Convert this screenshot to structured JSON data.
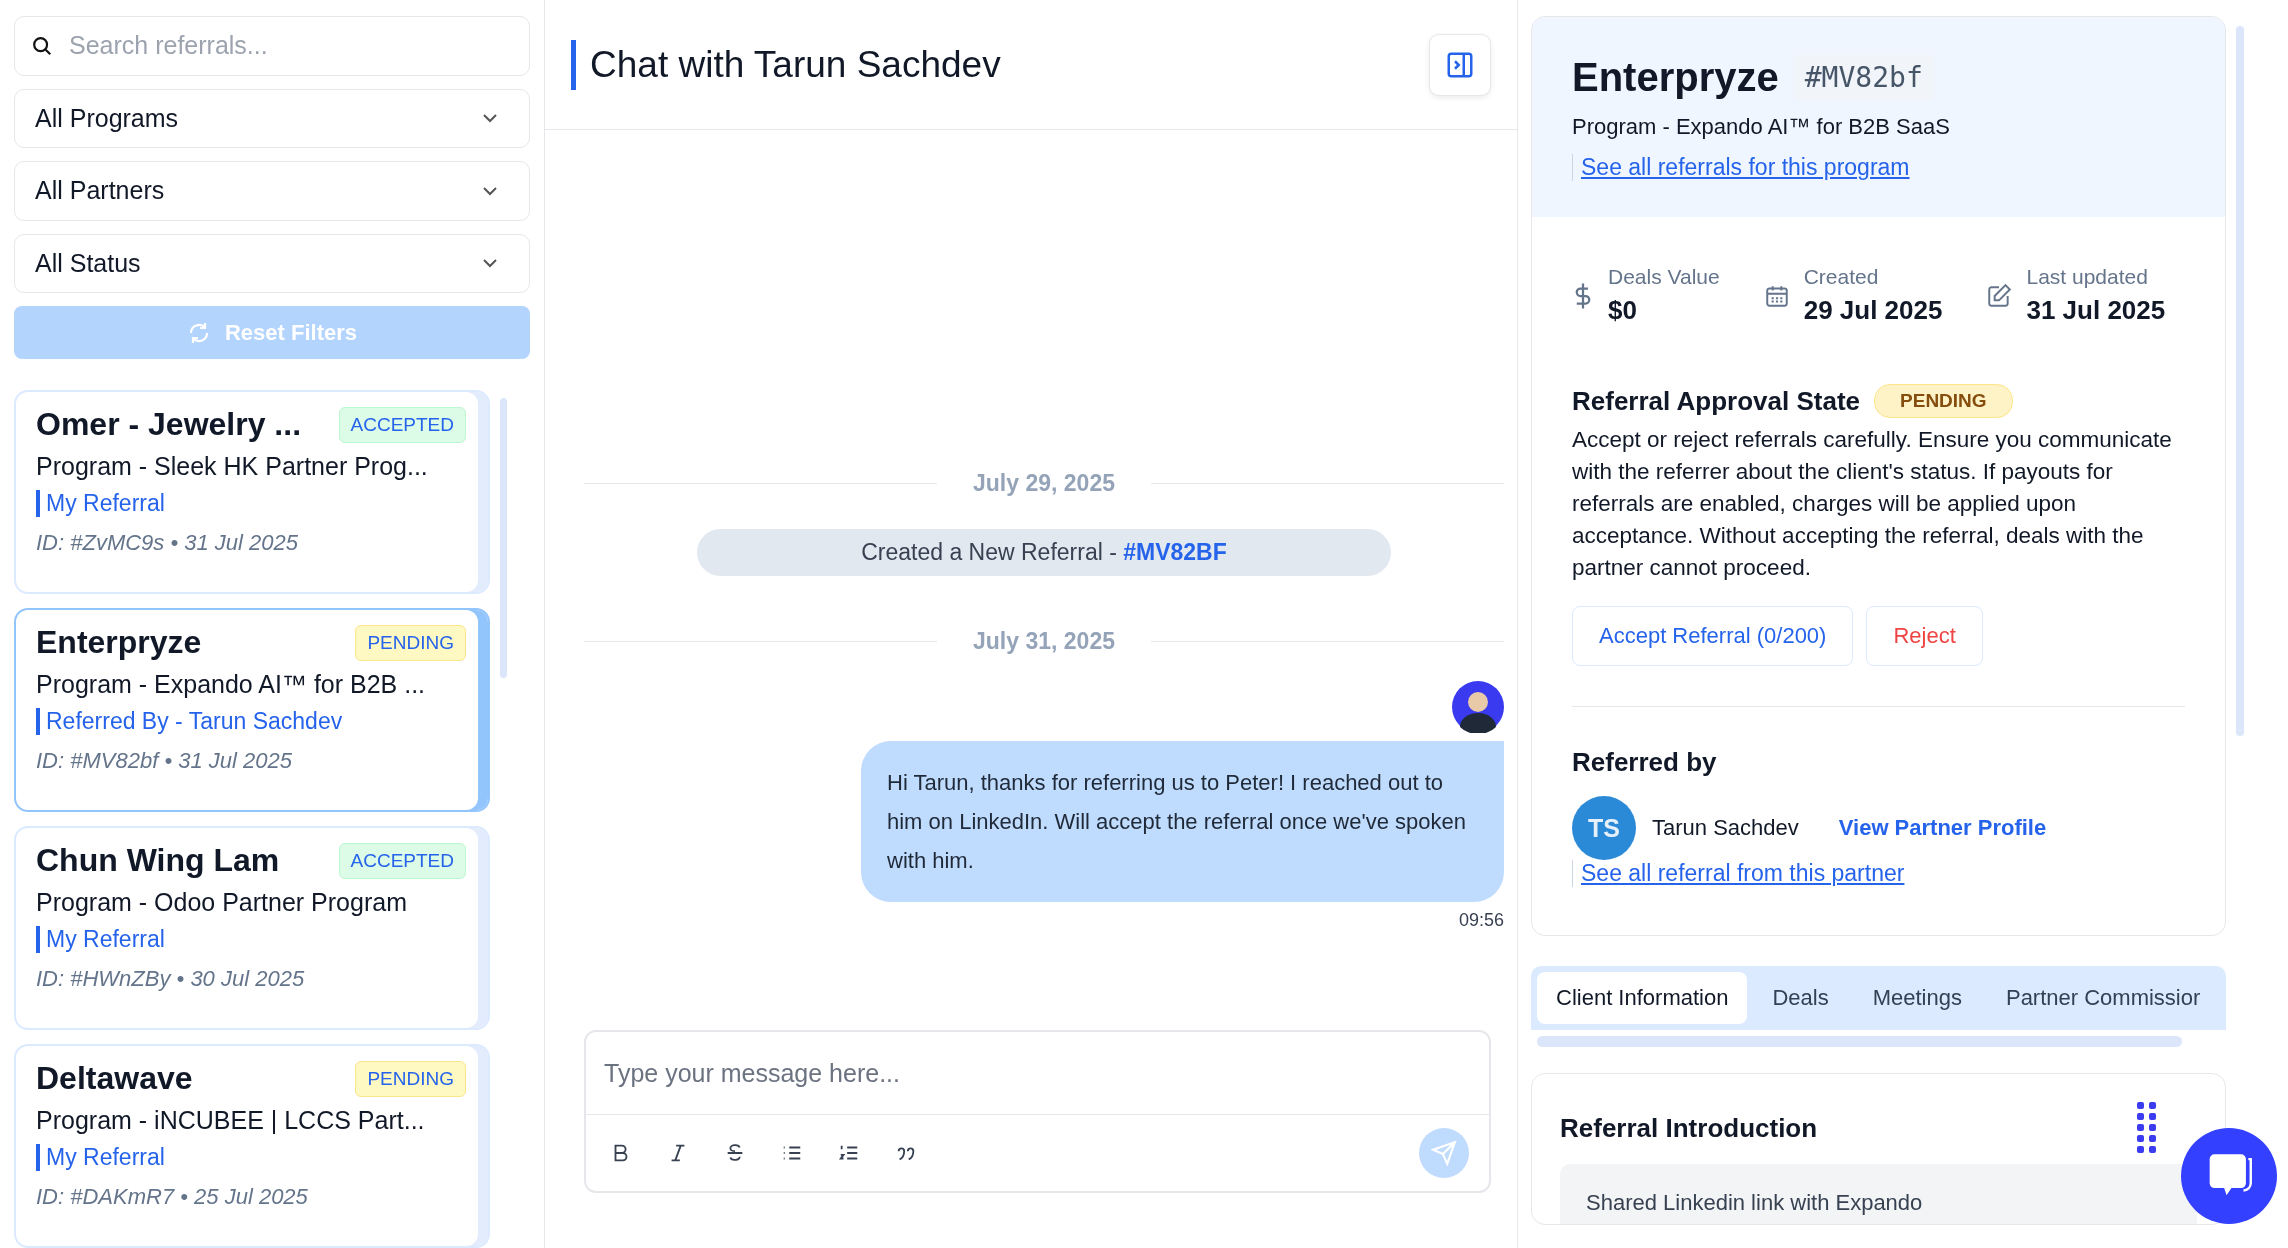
{
  "sidebar": {
    "search": {
      "placeholder": "Search referrals..."
    },
    "filters": [
      {
        "label": "All Programs"
      },
      {
        "label": "All Partners"
      },
      {
        "label": "All Status"
      }
    ],
    "reset_button": {
      "label": "Reset Filters",
      "disabled": true
    },
    "referrals": [
      {
        "title": "Omer - Jewelry ...",
        "status": "ACCEPTED",
        "kind": "accepted",
        "program": "Program - Sleek HK Partner Prog...",
        "link": "My Referral",
        "id_line": "ID: #ZvMC9s • 31 Jul 2025",
        "selected": false
      },
      {
        "title": "Enterpryze",
        "status": "PENDING",
        "kind": "pending",
        "program": "Program - Expando AI™ for B2B ...",
        "link": "Referred By - Tarun Sachdev",
        "id_line": "ID: #MV82bf • 31 Jul 2025",
        "selected": true
      },
      {
        "title": "Chun Wing Lam",
        "status": "ACCEPTED",
        "kind": "accepted",
        "program": "Program - Odoo Partner Program",
        "link": "My Referral",
        "id_line": "ID: #HWnZBy • 30 Jul 2025",
        "selected": false
      },
      {
        "title": "Deltawave",
        "status": "PENDING",
        "kind": "pending",
        "program": "Program - iNCUBEE | LCCS Part...",
        "link": "My Referral",
        "id_line": "ID: #DAKmR7 • 25 Jul 2025",
        "selected": false
      }
    ]
  },
  "chat": {
    "title": "Chat with Tarun Sachdev",
    "timeline": [
      {
        "kind": "date",
        "text": "July 29, 2025"
      },
      {
        "kind": "event",
        "text": "Created a New Referral - ",
        "ref": "#MV82BF"
      },
      {
        "kind": "date",
        "text": "July 31, 2025"
      },
      {
        "kind": "message",
        "text": "Hi Tarun, thanks for referring us to Peter! I reached out to him on LinkedIn. Will accept the referral once we've spoken with him.",
        "time": "09:56"
      }
    ],
    "composer": {
      "placeholder": "Type your message here..."
    }
  },
  "details": {
    "name": "Enterpryze",
    "ref": "#MV82bf",
    "program": "Program - Expando AI™ for B2B SaaS",
    "program_link": "See all referrals for this program",
    "stats": [
      {
        "kind": "money",
        "label": "Deals Value",
        "value": "$0"
      },
      {
        "kind": "date",
        "label": "Created",
        "value": "29 Jul 2025"
      },
      {
        "kind": "edit",
        "label": "Last updated",
        "value": "31 Jul 2025"
      }
    ],
    "approval": {
      "title": "Referral Approval State",
      "status": "PENDING",
      "text": "Accept or reject referrals carefully. Ensure you communicate with the referrer about the client's status. If payouts for referrals are enabled, charges will be applied upon acceptance. Without accepting the referral, deals with the partner cannot proceed.",
      "accept_button": "Accept Referral (0/200)",
      "reject_button": "Reject"
    },
    "referred_by": {
      "title": "Referred by",
      "initials": "TS",
      "name": "Tarun Sachdev",
      "profile_link": "View Partner Profile",
      "partner_link": "See all referral from this partner"
    },
    "tabs": [
      {
        "label": "Client Information",
        "selected": true
      },
      {
        "label": "Deals",
        "selected": false
      },
      {
        "label": "Meetings",
        "selected": false
      },
      {
        "label": "Partner Commissior",
        "selected": false
      }
    ],
    "introduction": {
      "title": "Referral Introduction",
      "text": "Shared Linkedin link with Expando"
    }
  }
}
